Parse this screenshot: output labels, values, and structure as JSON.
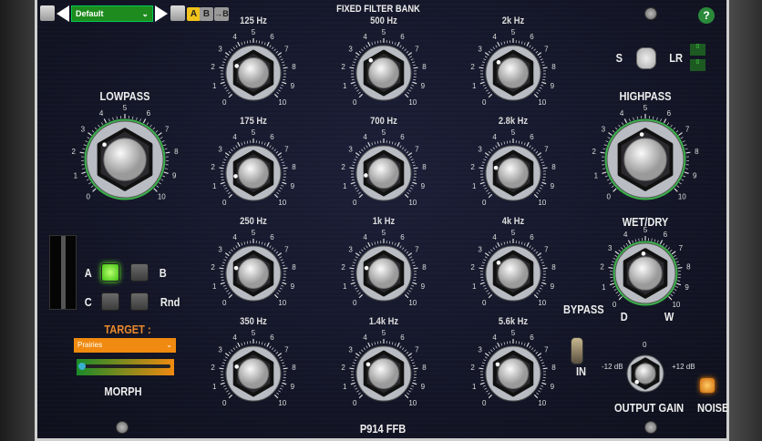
{
  "title": "FIXED FILTER BANK",
  "footer": "P914 FFB",
  "toolbar": {
    "preset": "Default",
    "a_label": "A",
    "b_label": "B",
    "copy_label": "→B",
    "help": "?"
  },
  "scale_labels": [
    "0",
    "1",
    "2",
    "3",
    "4",
    "5",
    "6",
    "7",
    "8",
    "9",
    "10"
  ],
  "filter_bands": [
    {
      "label": "125 Hz",
      "value": 2.5
    },
    {
      "label": "500 Hz",
      "value": 3.3
    },
    {
      "label": "2k Hz",
      "value": 3.0
    },
    {
      "label": "175 Hz",
      "value": 1.3
    },
    {
      "label": "700 Hz",
      "value": 1.4
    },
    {
      "label": "2.8k Hz",
      "value": 2.3
    },
    {
      "label": "250 Hz",
      "value": 2.3
    },
    {
      "label": "1k Hz",
      "value": 2.3
    },
    {
      "label": "4k Hz",
      "value": 3.0
    },
    {
      "label": "350 Hz",
      "value": 2.5
    },
    {
      "label": "1.4k Hz",
      "value": 2.8
    },
    {
      "label": "5.6k Hz",
      "value": 2.8
    }
  ],
  "lowpass": {
    "label": "LOWPASS",
    "value": 3.0
  },
  "highpass": {
    "label": "HIGHPASS",
    "value": 4.7
  },
  "wetdry": {
    "label": "WET/DRY",
    "value": 4.8,
    "d": "D",
    "w": "W"
  },
  "stereo": {
    "s": "S",
    "lr": "LR",
    "val1": "0",
    "val2": "0"
  },
  "morph": {
    "a": "A",
    "b": "B",
    "c": "C",
    "rnd": "Rnd",
    "target_label": "TARGET :",
    "target": "Prairies",
    "morph_label": "MORPH",
    "morph_value": 0
  },
  "bypass": {
    "label": "BYPASS",
    "in": "IN"
  },
  "output_gain": {
    "label": "OUTPUT GAIN",
    "min": "-12 dB",
    "mid": "0",
    "max": "+12 dB",
    "value": 0
  },
  "noise": {
    "label": "NOISE"
  },
  "colors": {
    "accent_green": "#3bb04a",
    "orange": "#f08a10",
    "led_on": "#7cff2a"
  }
}
